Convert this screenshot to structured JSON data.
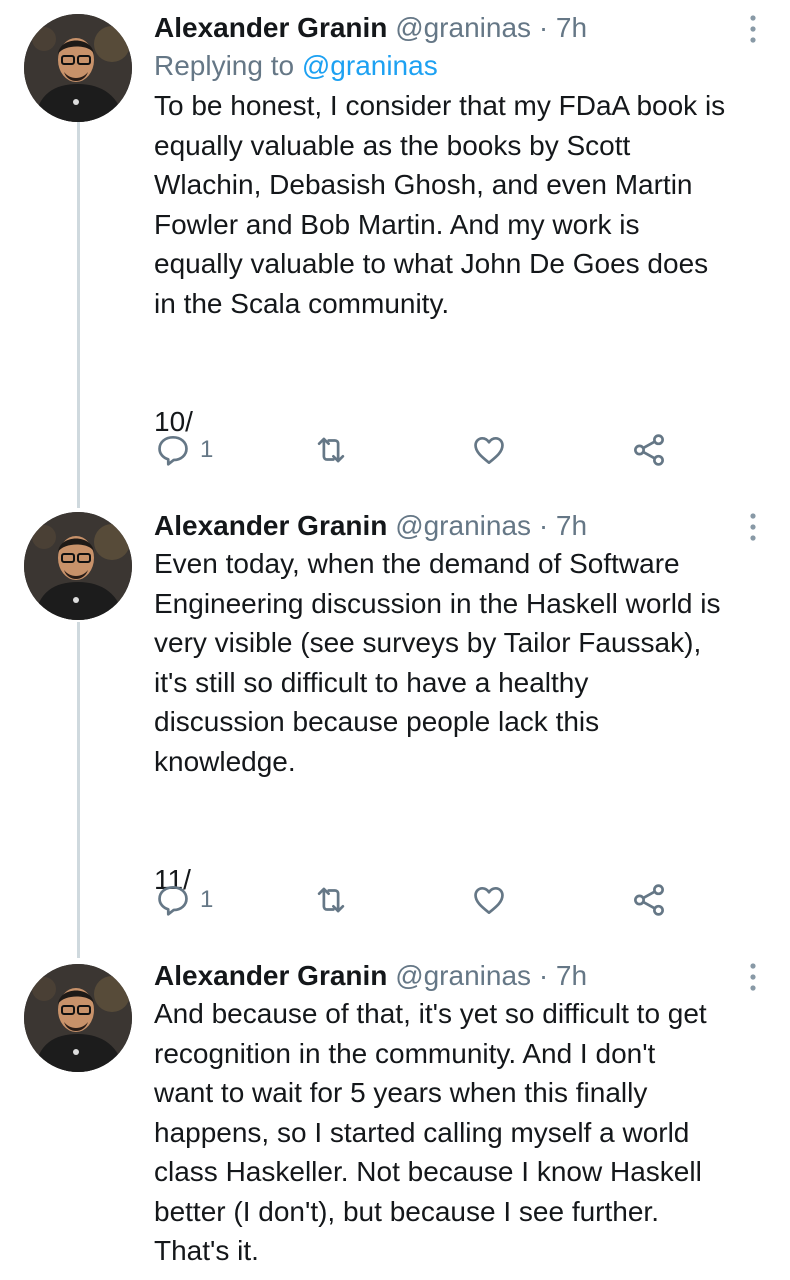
{
  "colors": {
    "text": "#14171a",
    "secondary": "#657786",
    "link": "#1da1f2",
    "thread_line": "#cfd9de"
  },
  "tweets": [
    {
      "author_name": "Alexander Granin",
      "author_handle": "@graninas",
      "separator": "·",
      "time": "7h",
      "replying_prefix": "Replying to ",
      "replying_handle": "@graninas",
      "text": "To be honest, I consider that my FDaA book is\nequally valuable as the books by Scott\nWlachin, Debasish Ghosh, and even Martin\nFowler and Bob Martin. And my work is\nequally valuable to what John De Goes does\nin the Scala community.\n\n\n10/",
      "reply_count": "1",
      "icons": [
        "reply-icon",
        "retweet-icon",
        "like-icon",
        "share-icon",
        "more-icon"
      ]
    },
    {
      "author_name": "Alexander Granin",
      "author_handle": "@graninas",
      "separator": "·",
      "time": "7h",
      "text": "Even today, when the demand of Software\nEngineering discussion in the Haskell world is\nvery visible (see surveys by Tailor Faussak),\nit's still so difficult to have a healthy\ndiscussion because people lack this\nknowledge.\n\n\n11/",
      "reply_count": "1",
      "icons": [
        "reply-icon",
        "retweet-icon",
        "like-icon",
        "share-icon",
        "more-icon"
      ]
    },
    {
      "author_name": "Alexander Granin",
      "author_handle": "@graninas",
      "separator": "·",
      "time": "7h",
      "text": "And because of that, it's yet so difficult to get\nrecognition in the community. And I don't\nwant to wait for 5 years when this finally\nhappens, so I started calling myself a world\nclass Haskeller. Not because I know Haskell\nbetter (I don't), but because I see further.\nThat's it.",
      "icons": [
        "more-icon"
      ]
    }
  ]
}
